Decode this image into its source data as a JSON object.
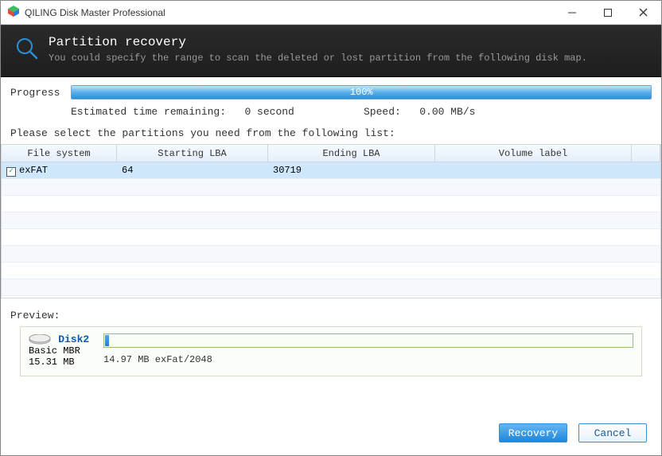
{
  "window": {
    "title": "QILING Disk Master Professional"
  },
  "header_band": {
    "title": "Partition recovery",
    "subtitle": "You could specify the range to scan the deleted or lost partition from the following disk map."
  },
  "progress": {
    "label": "Progress",
    "percent_text": "100%",
    "eta_label": "Estimated time remaining:",
    "eta_value": "0 second",
    "speed_label": "Speed:",
    "speed_value": "0.00 MB/s"
  },
  "instruction": "Please select the partitions you need from the following list:",
  "table": {
    "headers": {
      "file_system": "File system",
      "starting_lba": "Starting LBA",
      "ending_lba": "Ending LBA",
      "volume_label": "Volume label"
    },
    "rows": [
      {
        "checked": true,
        "file_system": "exFAT",
        "starting_lba": "64",
        "ending_lba": "30719",
        "volume_label": ""
      }
    ]
  },
  "preview": {
    "label": "Preview:",
    "disk_name": "Disk2",
    "disk_type": "Basic MBR",
    "disk_size": "15.31 MB",
    "segment_caption": "14.97 MB exFat/2048"
  },
  "footer": {
    "recovery": "Recovery",
    "cancel": "Cancel"
  },
  "icons": {
    "app_cube": "app-cube-icon",
    "magnifier": "magnifier-icon",
    "minimize": "minimize-icon",
    "maximize": "maximize-icon",
    "close": "close-icon"
  }
}
